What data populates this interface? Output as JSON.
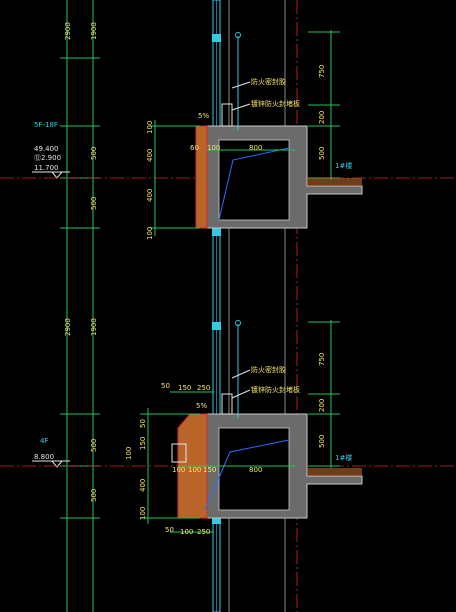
{
  "colors": {
    "bg": "#000000",
    "dim": "#22c55e",
    "text_yellow": "#f5e663",
    "text_cyan": "#35c9e6",
    "red": "#d12b2b",
    "wall": "#c8c8c8",
    "wall_fill": "#6b6b6b",
    "diag": "#2e6cff",
    "brick": "#b9652a",
    "white": "#e5e5e5"
  },
  "left_dims": {
    "top_1900": "1900",
    "top_2900": "2900",
    "mid_500a": "500",
    "mid_500b": "500",
    "lower_1900": "1900",
    "lower_2900": "2900",
    "lower_500a": "500",
    "lower_500b": "500"
  },
  "floor_5": {
    "tag": "5F-18F",
    "elev_1": "49.400",
    "elev_2": "⑫2.900",
    "elev_3": "11.700"
  },
  "floor_4": {
    "tag": "4F",
    "elev": "8.800"
  },
  "upper_detail": {
    "dim_100a": "100",
    "dim_400a": "400",
    "dim_400b": "400",
    "dim_100b": "100",
    "dim_60": "60",
    "dim_5": "5%",
    "dim_100c": "100",
    "dim_800": "800",
    "label_1": "防火密封胶",
    "label_2": "镀锌防火封堵板",
    "right_750": "750",
    "right_200": "200",
    "right_500": "500",
    "floor_tag": "1#楼"
  },
  "lower_detail": {
    "dim_50a": "50",
    "dim_150": "150",
    "dim_250a": "250",
    "dim_5": "5%",
    "dim_50b": "50",
    "dim_150b": "150",
    "dim_100a": "100",
    "dim_100b": "100",
    "dim_100c": "100",
    "dim_150c": "150",
    "dim_400": "400",
    "dim_100d": "100",
    "dim_800": "800",
    "dim_50c": "50",
    "dim_100e": "100",
    "dim_250b": "250",
    "label_1": "防火密封胶",
    "label_2": "镀锌防火封堵板",
    "right_750": "750",
    "right_200": "200",
    "right_500": "500",
    "floor_tag": "1#楼"
  }
}
